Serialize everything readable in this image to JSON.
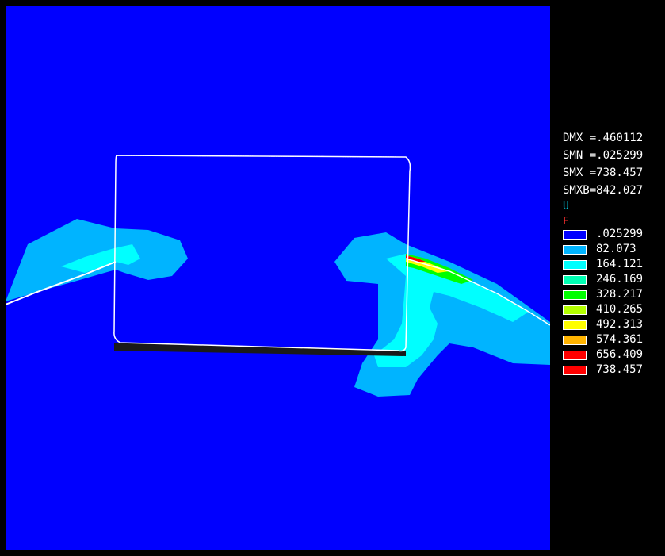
{
  "stats": {
    "dmx": "DMX =.460112",
    "smn": "SMN =.025299",
    "smx": "SMX =738.457",
    "smxb": "SMXB=842.027"
  },
  "tags": {
    "u": "U",
    "f": "F"
  },
  "tag_colors": {
    "u": "#00e5ff",
    "f": "#ff3030"
  },
  "legend": [
    {
      "value": ".025299",
      "color": "#0000ff"
    },
    {
      "value": "82.073",
      "color": "#00b4ff"
    },
    {
      "value": "164.121",
      "color": "#00ffff"
    },
    {
      "value": "246.169",
      "color": "#00ffb4"
    },
    {
      "value": "328.217",
      "color": "#00ff00"
    },
    {
      "value": "410.265",
      "color": "#b4ff00"
    },
    {
      "value": "492.313",
      "color": "#ffff00"
    },
    {
      "value": "574.361",
      "color": "#ffb400"
    },
    {
      "value": "656.409",
      "color": "#ff0000"
    },
    {
      "value": "738.457",
      "color": "#ff0000"
    }
  ],
  "viewport": {
    "background": "#0000ff"
  }
}
